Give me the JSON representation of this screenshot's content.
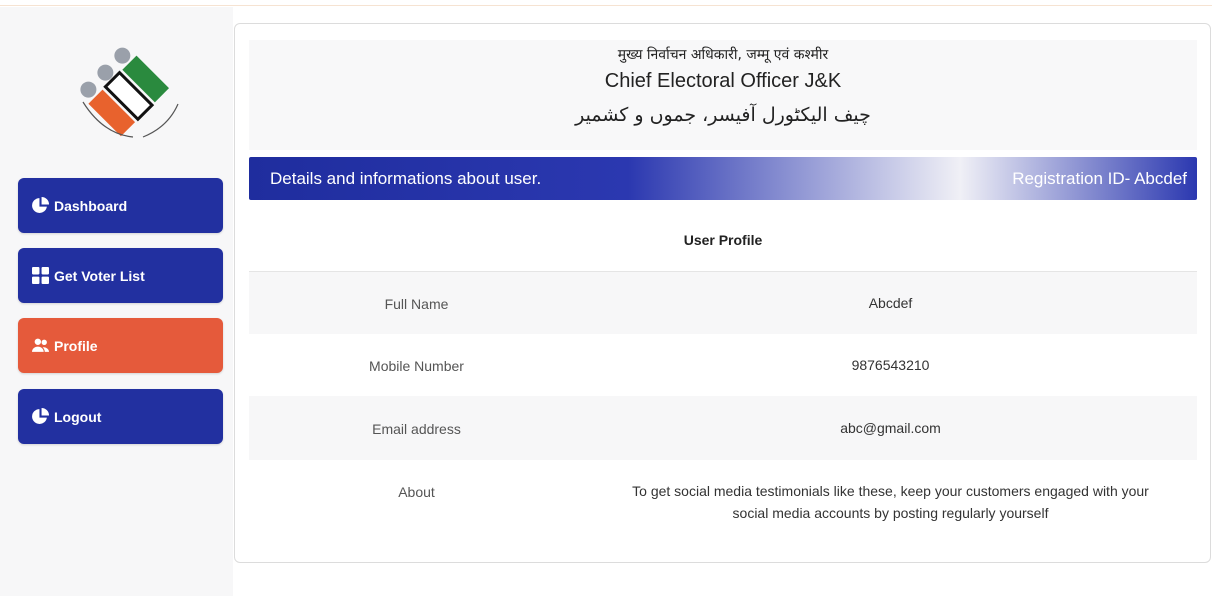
{
  "sidebar": {
    "items": [
      {
        "label": "Dashboard",
        "icon": "pie-chart-icon"
      },
      {
        "label": "Get Voter List",
        "icon": "grid-icon"
      },
      {
        "label": "Profile",
        "icon": "users-icon"
      },
      {
        "label": "Logout",
        "icon": "pie-chart-icon"
      }
    ]
  },
  "header": {
    "hindi": "मुख्य निर्वाचन अधिकारी, जम्मू एवं कश्मीर",
    "english": "Chief Electoral Officer J&K",
    "urdu": "چیف الیکٹورل آفیسر، جموں و کشمیر"
  },
  "bar": {
    "left": "Details and informations about user.",
    "right": "Registration ID- Abcdef"
  },
  "profile": {
    "title": "User Profile",
    "rows": [
      {
        "label": "Full Name",
        "value": "Abcdef"
      },
      {
        "label": "Mobile Number",
        "value": "9876543210"
      },
      {
        "label": "Email address",
        "value": "abc@gmail.com"
      },
      {
        "label": "About",
        "value": "To get social media testimonials like these, keep your customers engaged with your social media accounts by posting regularly yourself"
      }
    ]
  },
  "colors": {
    "nav_blue": "#2230a0",
    "nav_active": "#e55a3b",
    "logo_orange": "#e8622d",
    "logo_green": "#2a8a3e"
  }
}
